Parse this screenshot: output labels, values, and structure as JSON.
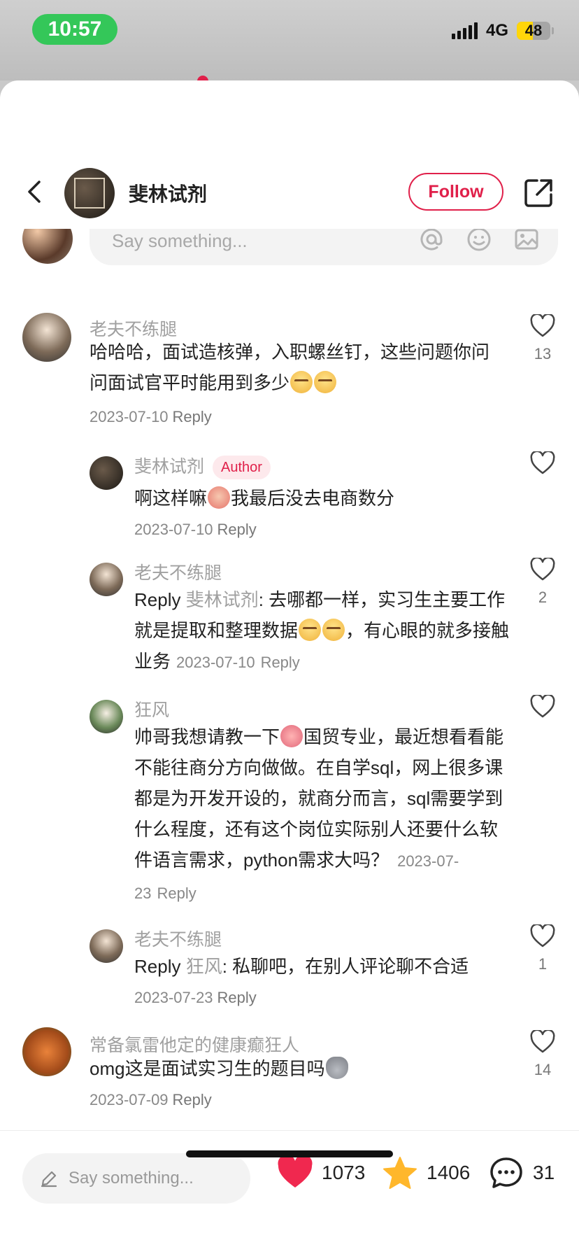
{
  "status_bar": {
    "time": "10:57",
    "network": "4G",
    "battery": "48",
    "battery_level": 0.48
  },
  "header": {
    "name": "斐林试剂",
    "follow_label": "Follow"
  },
  "composer": {
    "placeholder": "Say something..."
  },
  "comments": [
    {
      "user": "老夫不练腿",
      "text": "哈哈哈，面试造核弹，入职螺丝钉，这些问题你问问面试官平时能用到多少",
      "date": "2023-07-10",
      "reply_label": "Reply",
      "likes": "13",
      "emoji": "nerd-face-emoji",
      "replies": [
        {
          "user": "斐林试剂",
          "badge": "Author",
          "text_before": "啊这样嘛",
          "text_after": "我最后没去电商数分",
          "date": "2023-07-10",
          "reply_label": "Reply",
          "likes": ""
        },
        {
          "user": "老夫不练腿",
          "reply_prefix": "Reply",
          "reply_to": "斐林试剂",
          "text": ": 去哪都一样，实习生主要工作就是提取和整理数据",
          "text_tail": "，有心眼的就多接触业务",
          "date": "2023-07-10",
          "reply_label": "Reply",
          "likes": "2"
        },
        {
          "user": "狂风",
          "text_before": "帅哥我想请教一下",
          "text_after": "国贸专业，最近想看看能不能往商分方向做做。在自学sql，网上很多课都是为开发开设的，就商分而言，sql需要学到什么程度，还有这个岗位实际别人还要什么软件语言需求，python需求大吗？",
          "date": "2023-07-23",
          "reply_label": "Reply",
          "likes": ""
        },
        {
          "user": "老夫不练腿",
          "reply_prefix": "Reply",
          "reply_to": "狂风",
          "text": ": 私聊吧，在别人评论聊不合适",
          "date": "2023-07-23",
          "reply_label": "Reply",
          "likes": "1"
        }
      ]
    },
    {
      "user": "常备氯雷他定的健康癫狂人",
      "text": "omg这是面试实习生的题目吗",
      "date": "2023-07-09",
      "reply_label": "Reply",
      "likes": "14"
    }
  ],
  "bottom_bar": {
    "placeholder": "Say something...",
    "likes": "1073",
    "stars": "1406",
    "comments": "31"
  },
  "colors": {
    "accent": "#e0204a",
    "star": "#ffb72b",
    "time_pill": "#34c759"
  }
}
